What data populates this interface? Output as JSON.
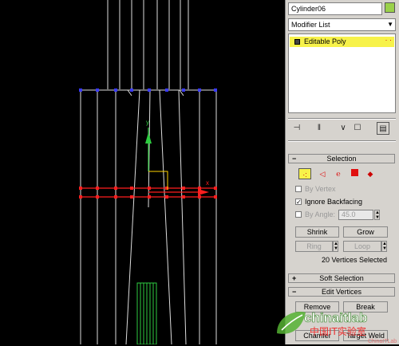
{
  "object_name": "Cylinder06",
  "modifier_list": {
    "value": "Modifier List"
  },
  "modifier_stack": {
    "items": [
      {
        "label": "Editable Poly"
      }
    ]
  },
  "stack_tools": [
    "pin-stack-icon",
    "show-end-result-icon",
    "make-unique-icon",
    "remove-modifier-icon",
    "configure-modifier-sets-icon"
  ],
  "selection": {
    "header": "Selection",
    "subobject_icons": [
      "vertex-icon",
      "edge-icon",
      "border-icon",
      "polygon-icon",
      "element-icon"
    ],
    "by_vertex": "By Vertex",
    "ignore_backfacing": "Ignore Backfacing",
    "by_angle": "By Angle:",
    "angle_value": "45.0",
    "shrink": "Shrink",
    "grow": "Grow",
    "ring": "Ring",
    "loop": "Loop",
    "status": "20 Vertices Selected"
  },
  "soft_selection": {
    "header": "Soft Selection"
  },
  "edit_vertices": {
    "header": "Edit Vertices",
    "remove": "Remove",
    "break": "Break",
    "chamfer": "Chamfer",
    "target_weld": "Target Weld"
  },
  "gizmo": {
    "y_label": "y",
    "x_label": "x"
  },
  "watermark": {
    "brand": "chinaitlab",
    "tagline": "中国IT实验室",
    "wordmark": "ChinaITLab"
  },
  "colors": {
    "selected_vertex": "#ff0000",
    "top_vertex": "#3a3aff",
    "accent_yellow": "#f7f24a",
    "swatch": "#9ad14a"
  }
}
